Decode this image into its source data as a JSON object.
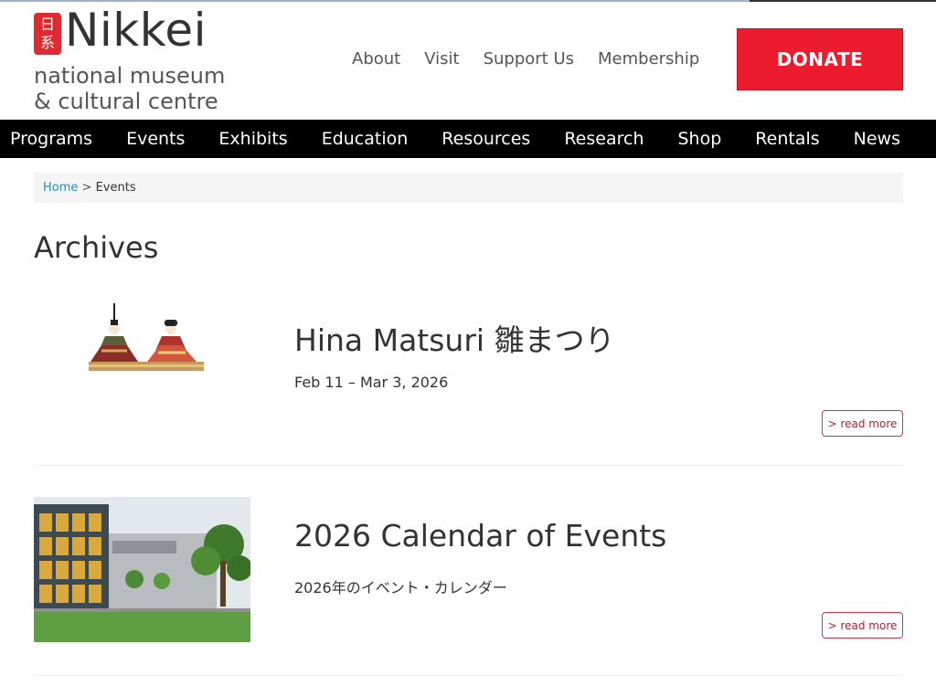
{
  "logo": {
    "seal_chars": [
      "日",
      "系"
    ],
    "word": "Nikkei",
    "line1": "national museum",
    "line2": "& cultural centre"
  },
  "util_nav": [
    "About",
    "Visit",
    "Support Us",
    "Membership"
  ],
  "donate_label": "DONATE",
  "main_nav": [
    "Programs",
    "Events",
    "Exhibits",
    "Education",
    "Resources",
    "Research",
    "Shop",
    "Rentals",
    "News"
  ],
  "breadcrumb": {
    "home": "Home",
    "separator": ">",
    "current": "Events"
  },
  "page_title": "Archives",
  "events": [
    {
      "title": "Hina Matsuri 雛まつり",
      "subtitle": "Feb 11 – Mar 3, 2026",
      "read_more": "> read more"
    },
    {
      "title": "2026 Calendar of Events",
      "subtitle": "2026年のイベント・カレンダー",
      "read_more": "> read more"
    }
  ],
  "colors": {
    "accent_red": "#ec1c2e",
    "nav_bg": "#000000",
    "link_blue": "#2a8bb0"
  }
}
